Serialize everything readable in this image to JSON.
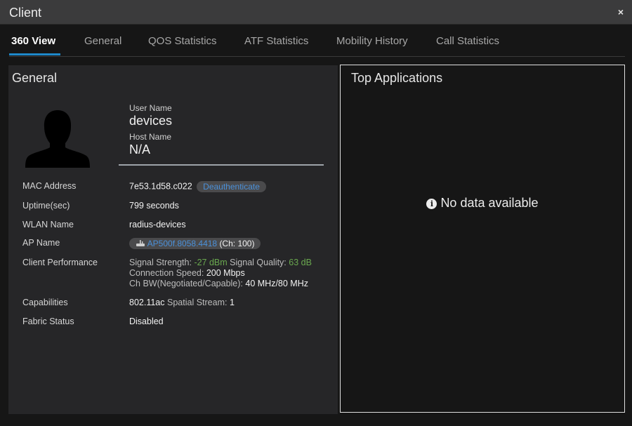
{
  "window": {
    "title": "Client",
    "close_symbol": "×"
  },
  "tabs": [
    {
      "label": "360 View",
      "active": true
    },
    {
      "label": "General"
    },
    {
      "label": "QOS Statistics"
    },
    {
      "label": "ATF Statistics"
    },
    {
      "label": "Mobility History"
    },
    {
      "label": "Call Statistics"
    }
  ],
  "general": {
    "heading": "General",
    "user_name_label": "User Name",
    "user_name": "devices",
    "host_name_label": "Host Name",
    "host_name": "N/A",
    "mac_label": "MAC Address",
    "mac": "7e53.1d58.c022",
    "deauth_label": "Deauthenticate",
    "uptime_label": "Uptime(sec)",
    "uptime": "799 seconds",
    "wlan_label": "WLAN Name",
    "wlan": "radius-devices",
    "ap_label": "AP Name",
    "ap_name": "AP500f.8058.4418",
    "ap_channel": "(Ch: 100)",
    "perf_label": "Client Performance",
    "signal_strength_label": "Signal Strength:",
    "signal_strength": "-27 dBm",
    "signal_quality_label": "Signal Quality:",
    "signal_quality": "63 dB",
    "conn_speed_label": "Connection Speed:",
    "conn_speed": "200 Mbps",
    "ch_bw_label": "Ch BW(Negotiated/Capable):",
    "ch_bw": "40 MHz/80 MHz",
    "capabilities_label": "Capabilities",
    "capabilities_std": "802.11ac",
    "spatial_stream_label": "Spatial Stream:",
    "spatial_stream": "1",
    "fabric_label": "Fabric Status",
    "fabric": "Disabled"
  },
  "top_apps": {
    "heading": "Top Applications",
    "info_glyph": "i",
    "empty_message": "No data available"
  },
  "icons": [
    "close-icon",
    "user-silhouette-icon",
    "access-point-icon",
    "info-icon"
  ],
  "colors": {
    "accent": "#1e88c9",
    "link": "#4a90d9",
    "good": "#6aa84f"
  }
}
